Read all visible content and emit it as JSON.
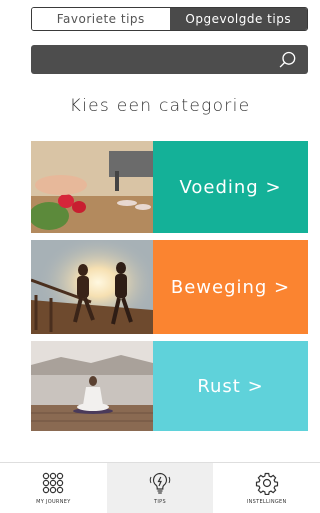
{
  "segmented": {
    "favorites_label": "Favoriete tips",
    "followed_label": "Opgevolgde tips"
  },
  "search": {
    "placeholder": "",
    "icon": "search-icon"
  },
  "section_title": "Kies een categorie",
  "categories": [
    {
      "label": "Voeding >",
      "color": "#14b198",
      "image": "food-photo"
    },
    {
      "label": "Beweging >",
      "color": "#fb8430",
      "image": "running-photo"
    },
    {
      "label": "Rust >",
      "color": "#5fd2da",
      "image": "meditation-photo"
    }
  ],
  "tabbar": {
    "items": [
      {
        "label": "MY JOURNEY",
        "icon": "journey-icon"
      },
      {
        "label": "TIPS",
        "icon": "lightbulb-icon",
        "active": true
      },
      {
        "label": "INSTELLINGEN",
        "icon": "gear-icon"
      }
    ]
  }
}
